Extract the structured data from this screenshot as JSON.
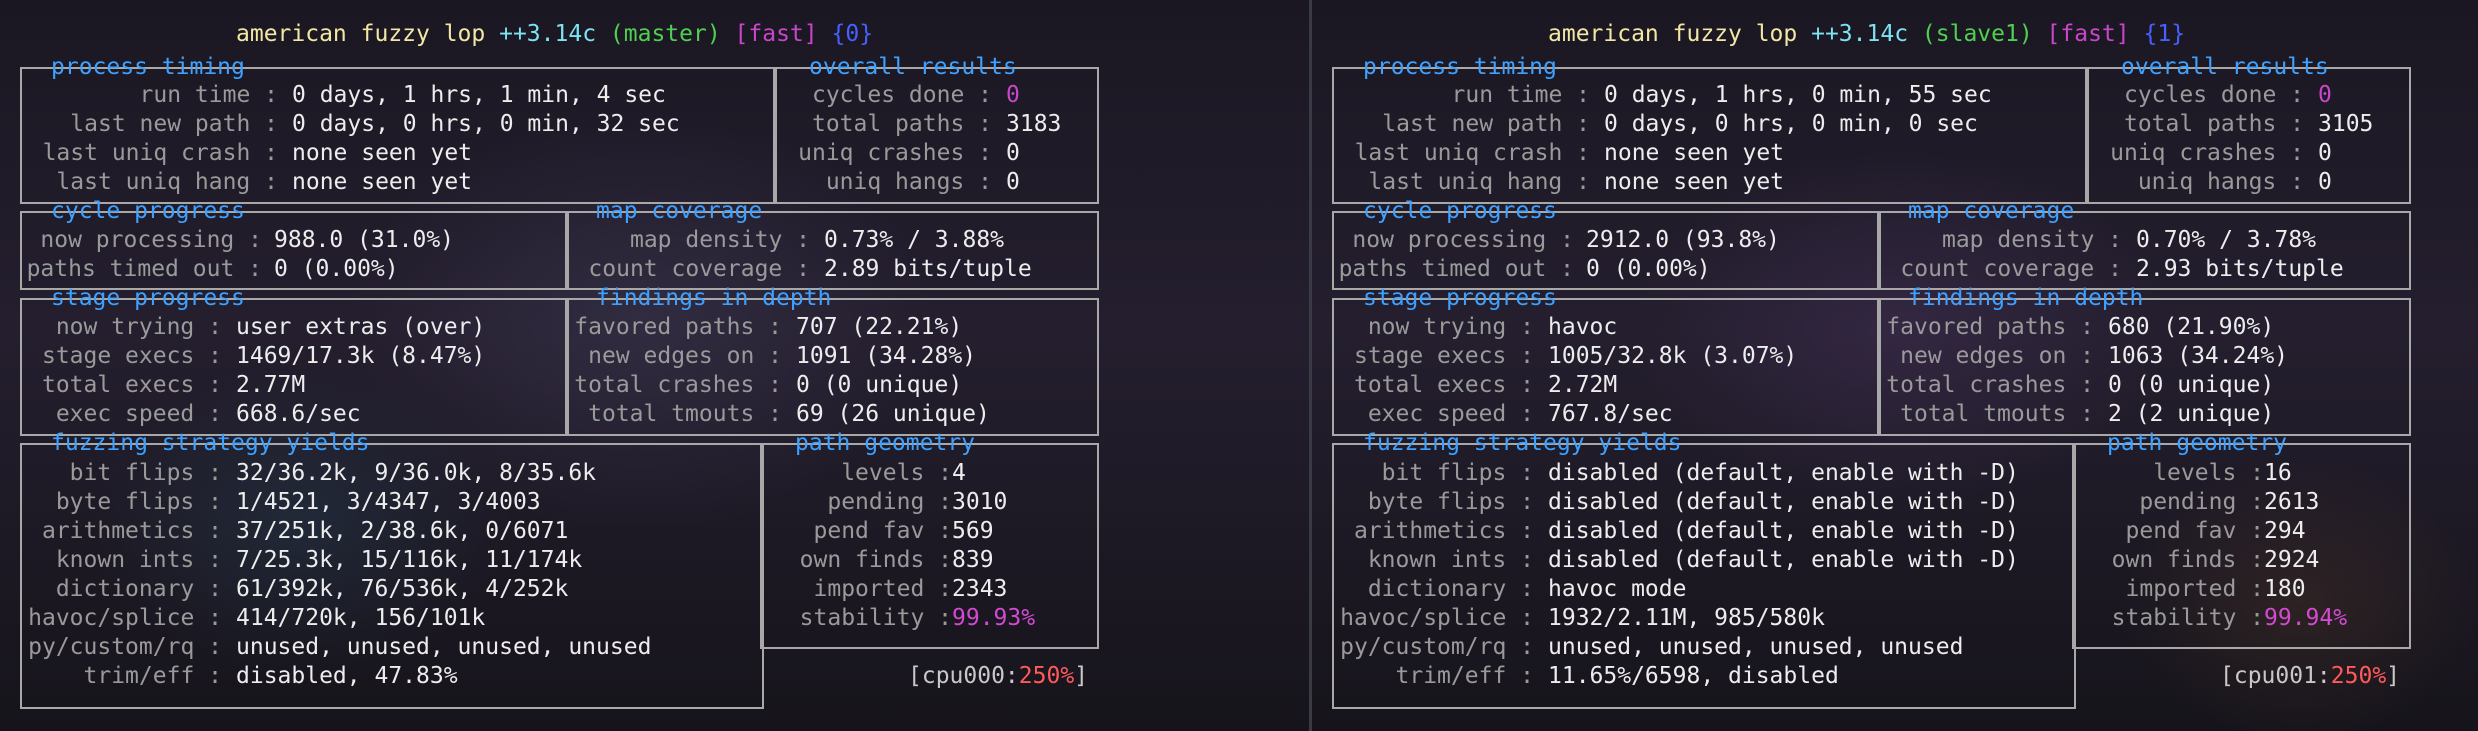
{
  "panes": [
    {
      "title": {
        "name": "american fuzzy lop",
        "version": "++3.14c",
        "role": "(master)",
        "mode": "[fast]",
        "id": "{0}"
      },
      "process_timing": {
        "heading": "process timing",
        "run_time_label": "run time",
        "run_time": "0 days, 1 hrs, 1 min, 4 sec",
        "last_new_path_label": "last new path",
        "last_new_path": "0 days, 0 hrs, 0 min, 32 sec",
        "last_uniq_crash_label": "last uniq crash",
        "last_uniq_crash": "none seen yet",
        "last_uniq_hang_label": "last uniq hang",
        "last_uniq_hang": "none seen yet"
      },
      "overall_results": {
        "heading": "overall results",
        "cycles_done_label": "cycles done",
        "cycles_done": "0",
        "total_paths_label": "total paths",
        "total_paths": "3183",
        "uniq_crashes_label": "uniq crashes",
        "uniq_crashes": "0",
        "uniq_hangs_label": "uniq hangs",
        "uniq_hangs": "0"
      },
      "cycle_progress": {
        "heading": "cycle progress",
        "now_processing_label": "now processing",
        "now_processing": "988.0 (31.0%)",
        "paths_timed_out_label": "paths timed out",
        "paths_timed_out": "0 (0.00%)"
      },
      "map_coverage": {
        "heading": "map coverage",
        "map_density_label": "map density",
        "map_density": "0.73% / 3.88%",
        "count_coverage_label": "count coverage",
        "count_coverage": "2.89 bits/tuple"
      },
      "stage_progress": {
        "heading": "stage progress",
        "now_trying_label": "now trying",
        "now_trying": "user extras (over)",
        "stage_execs_label": "stage execs",
        "stage_execs": "1469/17.3k (8.47%)",
        "total_execs_label": "total execs",
        "total_execs": "2.77M",
        "exec_speed_label": "exec speed",
        "exec_speed": "668.6/sec"
      },
      "findings": {
        "heading": "findings in depth",
        "favored_paths_label": "favored paths",
        "favored_paths": "707 (22.21%)",
        "new_edges_label": "new edges on",
        "new_edges": "1091 (34.28%)",
        "total_crashes_label": "total crashes",
        "total_crashes": "0 (0 unique)",
        "total_tmouts_label": "total tmouts",
        "total_tmouts": "69 (26 unique)"
      },
      "strategy": {
        "heading": "fuzzing strategy yields",
        "bit_flips_label": "bit flips",
        "bit_flips": "32/36.2k, 9/36.0k, 8/35.6k",
        "byte_flips_label": "byte flips",
        "byte_flips": "1/4521, 3/4347, 3/4003",
        "arithmetics_label": "arithmetics",
        "arithmetics": "37/251k, 2/38.6k, 0/6071",
        "known_ints_label": "known ints",
        "known_ints": "7/25.3k, 15/116k, 11/174k",
        "dictionary_label": "dictionary",
        "dictionary": "61/392k, 76/536k, 4/252k",
        "havoc_label": "havoc/splice",
        "havoc": "414/720k, 156/101k",
        "py_custom_label": "py/custom/rq",
        "py_custom": "unused, unused, unused, unused",
        "trim_label": "trim/eff",
        "trim": "disabled, 47.83%"
      },
      "geometry": {
        "heading": "path geometry",
        "levels_label": "levels",
        "levels": "4",
        "pending_label": "pending",
        "pending": "3010",
        "pend_fav_label": "pend fav",
        "pend_fav": "569",
        "own_finds_label": "own finds",
        "own_finds": "839",
        "imported_label": "imported",
        "imported": "2343",
        "stability_label": "stability",
        "stability": "99.93%"
      },
      "cpu": {
        "prefix": "[cpu000:",
        "value": "250%",
        "suffix": "]"
      }
    },
    {
      "title": {
        "name": "american fuzzy lop",
        "version": "++3.14c",
        "role": "(slave1)",
        "mode": "[fast]",
        "id": "{1}"
      },
      "process_timing": {
        "heading": "process timing",
        "run_time_label": "run time",
        "run_time": "0 days, 1 hrs, 0 min, 55 sec",
        "last_new_path_label": "last new path",
        "last_new_path": "0 days, 0 hrs, 0 min, 0 sec",
        "last_uniq_crash_label": "last uniq crash",
        "last_uniq_crash": "none seen yet",
        "last_uniq_hang_label": "last uniq hang",
        "last_uniq_hang": "none seen yet"
      },
      "overall_results": {
        "heading": "overall results",
        "cycles_done_label": "cycles done",
        "cycles_done": "0",
        "total_paths_label": "total paths",
        "total_paths": "3105",
        "uniq_crashes_label": "uniq crashes",
        "uniq_crashes": "0",
        "uniq_hangs_label": "uniq hangs",
        "uniq_hangs": "0"
      },
      "cycle_progress": {
        "heading": "cycle progress",
        "now_processing_label": "now processing",
        "now_processing": "2912.0 (93.8%)",
        "paths_timed_out_label": "paths timed out",
        "paths_timed_out": "0 (0.00%)"
      },
      "map_coverage": {
        "heading": "map coverage",
        "map_density_label": "map density",
        "map_density": "0.70% / 3.78%",
        "count_coverage_label": "count coverage",
        "count_coverage": "2.93 bits/tuple"
      },
      "stage_progress": {
        "heading": "stage progress",
        "now_trying_label": "now trying",
        "now_trying": "havoc",
        "stage_execs_label": "stage execs",
        "stage_execs": "1005/32.8k (3.07%)",
        "total_execs_label": "total execs",
        "total_execs": "2.72M",
        "exec_speed_label": "exec speed",
        "exec_speed": "767.8/sec"
      },
      "findings": {
        "heading": "findings in depth",
        "favored_paths_label": "favored paths",
        "favored_paths": "680 (21.90%)",
        "new_edges_label": "new edges on",
        "new_edges": "1063 (34.24%)",
        "total_crashes_label": "total crashes",
        "total_crashes": "0 (0 unique)",
        "total_tmouts_label": "total tmouts",
        "total_tmouts": "2 (2 unique)"
      },
      "strategy": {
        "heading": "fuzzing strategy yields",
        "bit_flips_label": "bit flips",
        "bit_flips": "disabled (default, enable with -D)",
        "byte_flips_label": "byte flips",
        "byte_flips": "disabled (default, enable with -D)",
        "arithmetics_label": "arithmetics",
        "arithmetics": "disabled (default, enable with -D)",
        "known_ints_label": "known ints",
        "known_ints": "disabled (default, enable with -D)",
        "dictionary_label": "dictionary",
        "dictionary": "havoc mode",
        "havoc_label": "havoc/splice",
        "havoc": "1932/2.11M, 985/580k",
        "py_custom_label": "py/custom/rq",
        "py_custom": "unused, unused, unused, unused",
        "trim_label": "trim/eff",
        "trim": "11.65%/6598, disabled"
      },
      "geometry": {
        "heading": "path geometry",
        "levels_label": "levels",
        "levels": "16",
        "pending_label": "pending",
        "pending": "2613",
        "pend_fav_label": "pend fav",
        "pend_fav": "294",
        "own_finds_label": "own finds",
        "own_finds": "2924",
        "imported_label": "imported",
        "imported": "180",
        "stability_label": "stability",
        "stability": "99.94%"
      },
      "cpu": {
        "prefix": "[cpu001:",
        "value": "250%",
        "suffix": "]"
      }
    }
  ]
}
